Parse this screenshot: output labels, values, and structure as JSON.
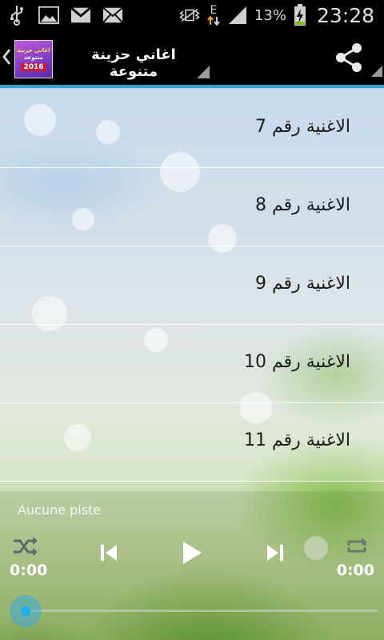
{
  "status_bar": {
    "network_type": "E",
    "battery_percent": "13%",
    "time": "23:28",
    "icons": [
      "usb-icon",
      "image-icon",
      "gmail-icon",
      "mail-icon",
      "vibrate-icon",
      "data-arrows-icon",
      "signal-icon",
      "battery-charging-icon"
    ]
  },
  "action_bar": {
    "title": "اغاني حزينة متنوعة",
    "app_icon": {
      "line1": "اغاني حزينة",
      "line2": "متنوعة",
      "line3": "2016"
    }
  },
  "tracks": [
    {
      "label": "الاغنية رقم 7"
    },
    {
      "label": "الاغنية رقم 8"
    },
    {
      "label": "الاغنية رقم 9"
    },
    {
      "label": "الاغنية رقم 10"
    },
    {
      "label": "الاغنية رقم 11"
    }
  ],
  "player": {
    "track_name": "Aucune piste",
    "elapsed": "0:00",
    "duration": "0:00",
    "progress": 0
  },
  "colors": {
    "accent": "#3aa0d0",
    "seek_thumb": "#22b0ea"
  }
}
